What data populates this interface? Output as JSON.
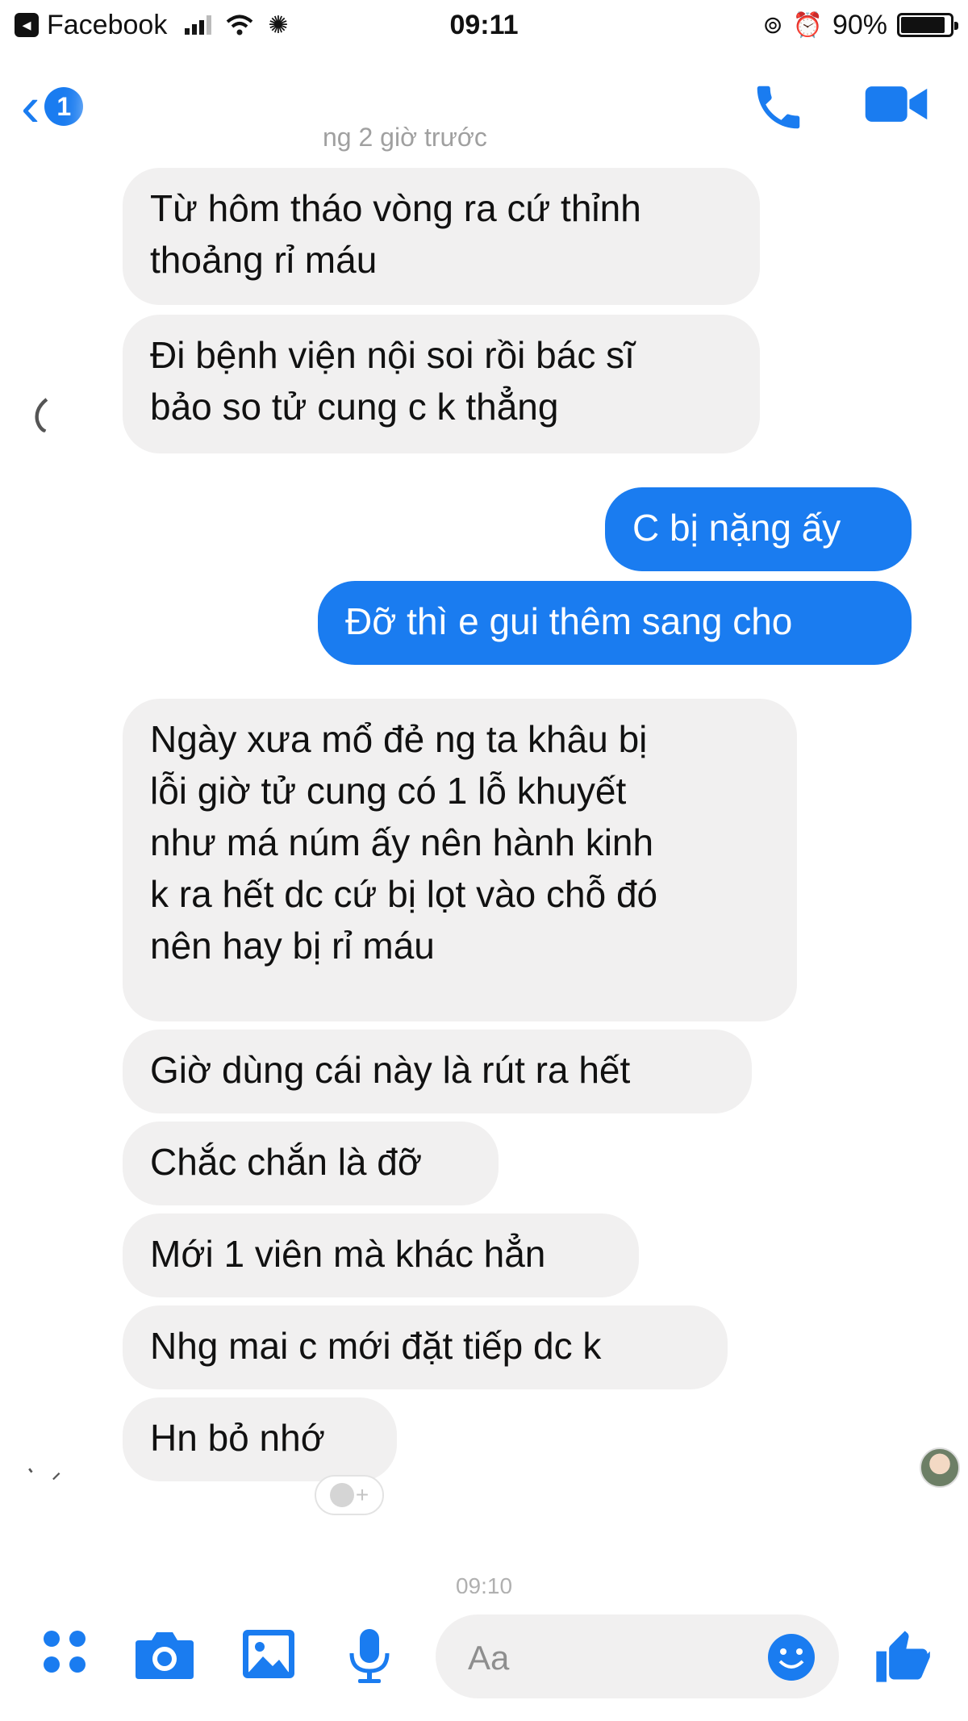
{
  "status_bar": {
    "app_back_label": "Facebook",
    "time": "09:11",
    "battery_text": "90%",
    "battery_level": 0.9
  },
  "header": {
    "unread_count": "1",
    "active_status": "ng 2 giờ trước"
  },
  "messages": [
    {
      "direction": "in",
      "lines": [
        "Từ hôm tháo vòng ra cứ thỉnh",
        "thoảng rỉ máu"
      ]
    },
    {
      "direction": "in",
      "lines": [
        "Đi bệnh viện nội soi rồi bác sĩ",
        "bảo so tử cung c k thẳng"
      ]
    },
    {
      "direction": "out",
      "lines": [
        "C bị nặng ấy"
      ]
    },
    {
      "direction": "out",
      "lines": [
        "Đỡ thì e gui thêm sang cho"
      ]
    },
    {
      "direction": "in",
      "lines": [
        "Ngày xưa mổ đẻ ng ta khâu bị",
        "lỗi giờ tử cung có 1 lỗ khuyết",
        "như má núm ấy nên hành kinh",
        "k ra hết dc cứ bị lọt vào chỗ đó",
        "nên hay bị rỉ máu"
      ]
    },
    {
      "direction": "in",
      "lines": [
        "Giờ dùng cái này là rút ra hết"
      ]
    },
    {
      "direction": "in",
      "lines": [
        "Chắc chắn là đỡ"
      ]
    },
    {
      "direction": "in",
      "lines": [
        "Mới 1 viên mà khác hẳn"
      ]
    },
    {
      "direction": "in",
      "lines": [
        "Nhg mai c mới đặt tiếp dc k"
      ]
    },
    {
      "direction": "in",
      "lines": [
        "Hn bỏ nhớ"
      ]
    }
  ],
  "timestamp": "09:10",
  "composer": {
    "placeholder": "Aa"
  },
  "colors": {
    "accent": "#1a7cf0",
    "incoming_bubble": "#f1f0f0",
    "outgoing_text": "#ffffff"
  },
  "icons": [
    "back-chevron-icon",
    "phone-icon",
    "video-camera-icon",
    "apps-grid-icon",
    "camera-icon",
    "image-icon",
    "microphone-icon",
    "emoji-icon",
    "thumbs-up-icon",
    "add-reaction-icon"
  ]
}
